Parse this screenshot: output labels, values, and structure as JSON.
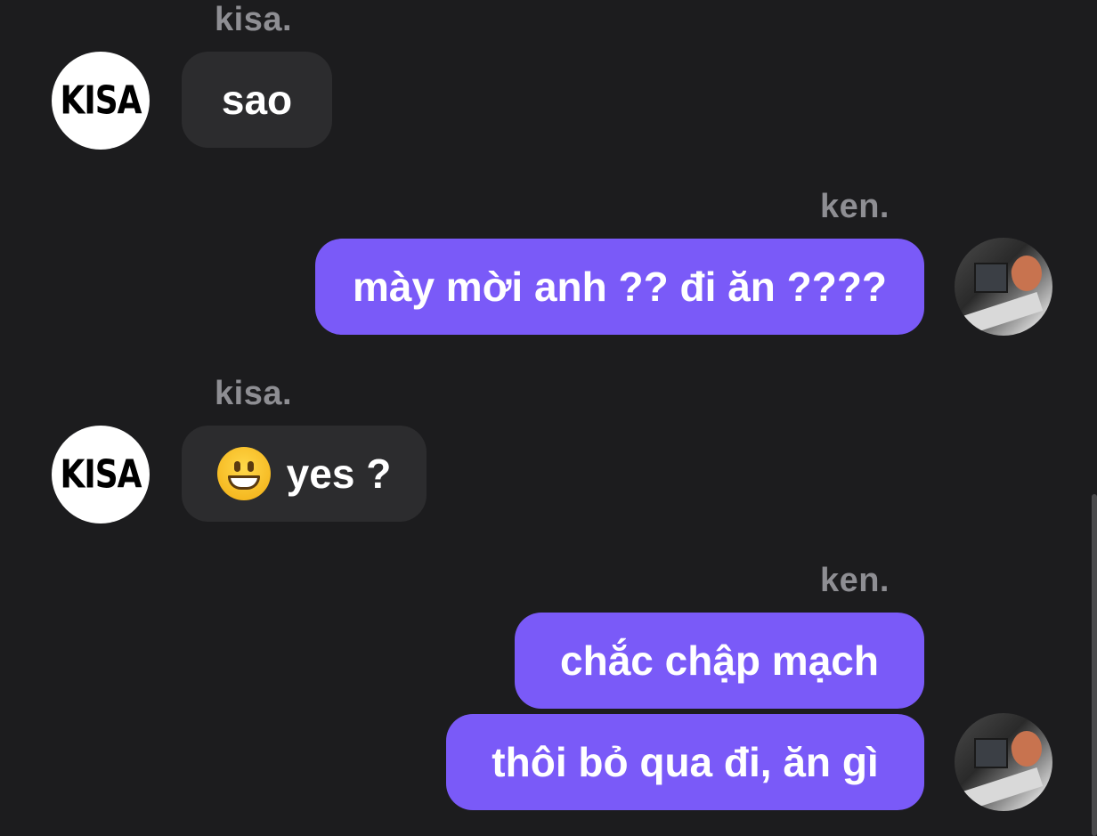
{
  "messages": [
    {
      "sender": "kisa.",
      "text": "sao",
      "direction": "in"
    },
    {
      "sender": "ken.",
      "text": "mày mời anh ?? đi ăn ????",
      "direction": "out"
    },
    {
      "sender": "kisa.",
      "emoji": "grinning-face",
      "text": "yes ?",
      "direction": "in"
    },
    {
      "sender": "ken.",
      "text": "chắc chập mạch",
      "direction": "out"
    },
    {
      "text": "thôi bỏ qua đi, ăn gì",
      "direction": "out"
    }
  ],
  "avatars": {
    "kisa": {
      "logo_text": "KISA",
      "bg": "#ffffff"
    },
    "ken": {
      "type": "photo"
    }
  },
  "colors": {
    "background": "#1c1c1e",
    "incoming_bubble": "#2c2c2e",
    "outgoing_bubble": "#7a5af8",
    "sender_name": "#8e8e93",
    "text": "#ffffff"
  }
}
